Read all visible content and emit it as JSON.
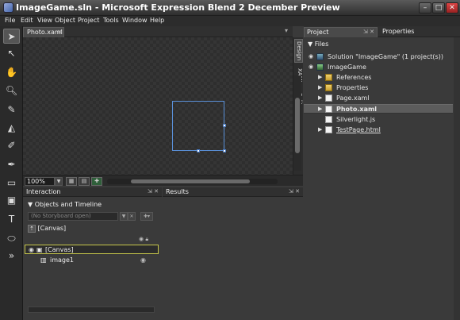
{
  "window": {
    "title": "ImageGame.sln - Microsoft Expression Blend 2 December Preview"
  },
  "menu": [
    "File",
    "Edit",
    "View",
    "Object",
    "Project",
    "Tools",
    "Window",
    "Help"
  ],
  "document": {
    "tab_label": "Photo.xaml",
    "zoom": "100%"
  },
  "view_modes": [
    "Design",
    "XAML",
    "Split"
  ],
  "interaction_panel": {
    "title": "Interaction",
    "objects_title": "Objects and Timeline",
    "storyboard_placeholder": "(No Storyboard open)",
    "scope": "[Canvas]",
    "tree": [
      "[Canvas]",
      "image1"
    ]
  },
  "results_panel": {
    "title": "Results"
  },
  "project_panel": {
    "tab_project": "Project",
    "tab_properties": "Properties",
    "files_header": "Files",
    "items": [
      "Solution \"ImageGame\" (1 project(s))",
      "ImageGame",
      "References",
      "Properties",
      "Page.xaml",
      "Photo.xaml",
      "Silverlight.js",
      "TestPage.html"
    ]
  },
  "icons": {
    "tools": [
      "selection-icon",
      "direct-select-icon",
      "pan-icon",
      "zoom-icon",
      "eyedropper-icon",
      "paint-bucket-icon",
      "brush-transform-icon",
      "pen-icon",
      "rectangle-icon",
      "layout-panel-icon",
      "text-icon",
      "button-control-icon",
      "asset-library-icon"
    ]
  },
  "colors": {
    "accent": "#5a90d8",
    "selection_outline": "#c8c84a"
  }
}
